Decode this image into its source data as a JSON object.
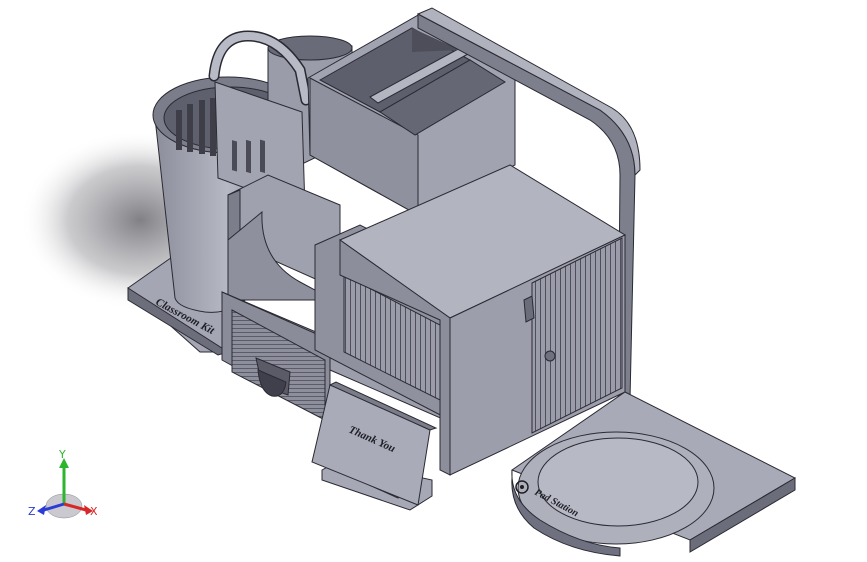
{
  "model": {
    "engraving_base": "Classroom Kit",
    "engraving_card": "Thank You",
    "engraving_tray": "Pad Station"
  },
  "triad": {
    "x": "X",
    "y": "Y",
    "z": "Z"
  },
  "colors": {
    "background": "#ffffff",
    "part_light": "#a9abb8",
    "part_mid": "#8b8d9b",
    "part_dark": "#5b5c69",
    "edge": "#2a2a33",
    "axis_x": "#d62828",
    "axis_y": "#2db52d",
    "axis_z": "#2b3bd6"
  }
}
